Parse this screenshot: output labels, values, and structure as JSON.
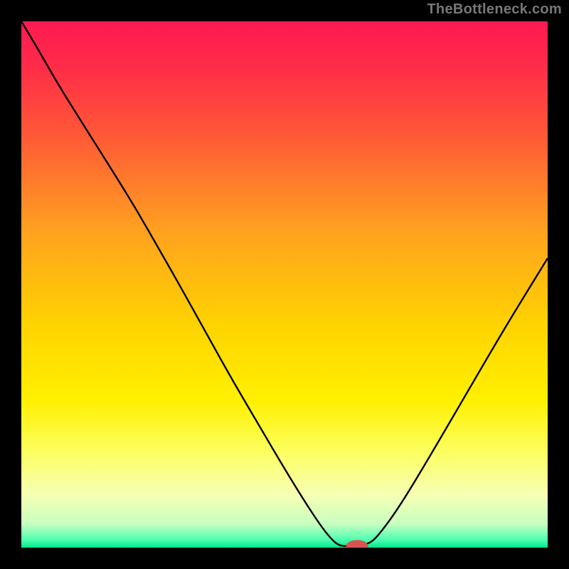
{
  "watermark": "TheBottleneck.com",
  "chart_data": {
    "type": "line",
    "title": "",
    "xlabel": "",
    "ylabel": "",
    "xlim": [
      0,
      100
    ],
    "ylim": [
      0,
      100
    ],
    "background_gradient_stops": [
      {
        "offset": 0.0,
        "color": "#ff1a52"
      },
      {
        "offset": 0.08,
        "color": "#ff2a49"
      },
      {
        "offset": 0.22,
        "color": "#ff5a36"
      },
      {
        "offset": 0.4,
        "color": "#ffa21f"
      },
      {
        "offset": 0.58,
        "color": "#ffd400"
      },
      {
        "offset": 0.72,
        "color": "#fff000"
      },
      {
        "offset": 0.82,
        "color": "#fcff62"
      },
      {
        "offset": 0.9,
        "color": "#f6ffb4"
      },
      {
        "offset": 0.955,
        "color": "#c7ffc0"
      },
      {
        "offset": 0.985,
        "color": "#4dffb0"
      },
      {
        "offset": 1.0,
        "color": "#00e58a"
      }
    ],
    "series": [
      {
        "name": "curve",
        "color": "#000000",
        "width": 2.4,
        "x": [
          0,
          3,
          7,
          12,
          18,
          22,
          26,
          30,
          35,
          40,
          45,
          50,
          54,
          57,
          59,
          60.5,
          62.5,
          66,
          68,
          72,
          78,
          85,
          92,
          100
        ],
        "y": [
          100,
          95,
          88,
          80,
          70.5,
          64,
          57,
          50,
          41,
          32,
          23.5,
          15,
          8.5,
          4,
          1.5,
          0.3,
          0.3,
          0.6,
          2.5,
          8,
          18,
          30,
          42,
          55
        ]
      }
    ],
    "marker": {
      "name": "optimum-marker",
      "color": "#d9534f",
      "x": 63.8,
      "y": 0.3,
      "rx": 2.1,
      "ry": 1.15
    }
  }
}
